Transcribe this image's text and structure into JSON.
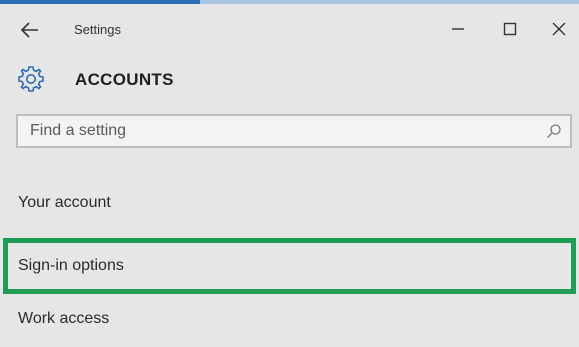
{
  "window": {
    "title": "Settings",
    "minimize_glyph": "–",
    "maximize_glyph": "□",
    "close_glyph": "✕"
  },
  "header": {
    "title": "ACCOUNTS",
    "icon": "gear-icon"
  },
  "search": {
    "placeholder": "Find a setting",
    "value": "",
    "icon": "search-icon"
  },
  "nav": {
    "items": [
      {
        "label": "Your account"
      },
      {
        "label": "Sign-in options",
        "highlighted": true
      },
      {
        "label": "Work access"
      }
    ]
  },
  "colors": {
    "accent": "#2d6db3",
    "highlight_border": "#1f9d55",
    "background": "#e6e6e6"
  }
}
